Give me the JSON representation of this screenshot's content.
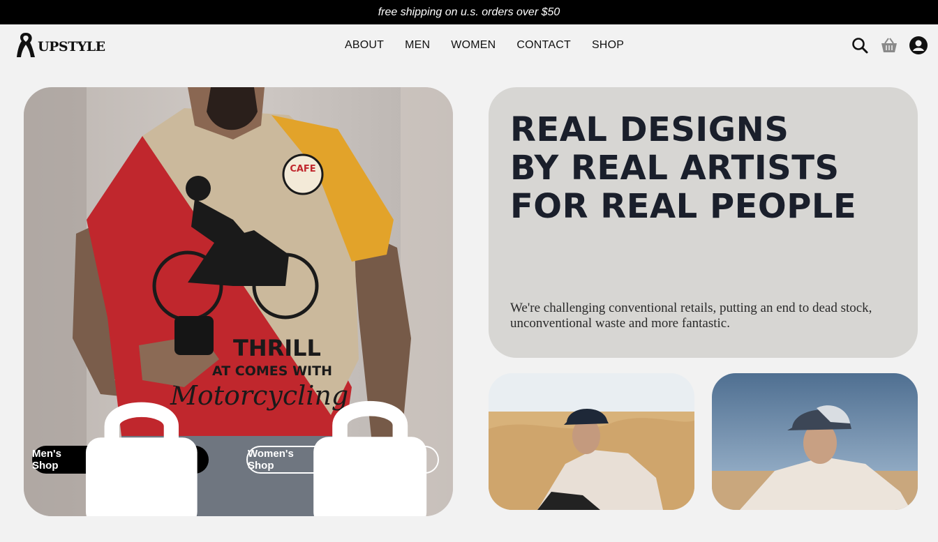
{
  "announcement": "free shipping on u.s. orders over $50",
  "brand": {
    "name": "UPSTYLE"
  },
  "nav": [
    "ABOUT",
    "MEN",
    "WOMEN",
    "CONTACT",
    "SHOP"
  ],
  "hero": {
    "headline": [
      "REAL DESIGNS",
      "BY REAL ARTISTS",
      "FOR REAL PEOPLE"
    ],
    "description": "We're challenging conventional retails, putting an end to dead stock, unconventional waste and more fantastic.",
    "shirt_print": {
      "badge": "CAFE",
      "line1": "THRILL",
      "line2": "AT COMES WITH",
      "line3": "Motorcycling"
    }
  },
  "buttons": {
    "men": "Men's Shop",
    "women": "Women's Shop"
  },
  "icons": {
    "search": "search-icon",
    "cart": "basket-icon",
    "account": "user-icon",
    "bag": "shopping-bag-icon"
  },
  "colors": {
    "accent_dark": "#1a1f2b",
    "card_bg": "#d7d6d3",
    "page_bg": "#f2f2f2"
  }
}
